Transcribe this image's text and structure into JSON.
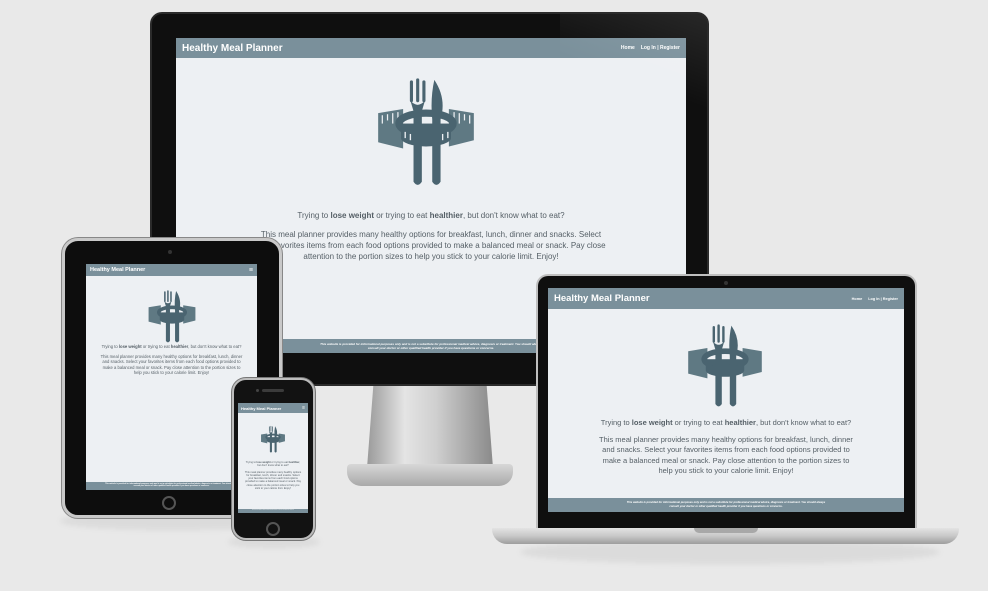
{
  "site": {
    "brand": "Healthy Meal Planner",
    "nav": {
      "home": "Home",
      "login": "Log In | Register"
    },
    "menu_icon": "≡",
    "hero_icon": "fork-knife-tape-measure-icon",
    "intro": {
      "lead": "Trying to ",
      "bold1": "lose weight",
      "mid": " or trying to eat ",
      "bold2": "healthier",
      "tail": ", but don't know what to eat?"
    },
    "description": "This meal planner provides many healthy options for breakfast, lunch, dinner and snacks. Select your favorites items from each food options provided to make a balanced meal or snack. Pay close attention to the portion sizes to help you stick to your calorie limit. Enjoy!",
    "footer": {
      "line1": "This website is provided for informational purposes only and is not a substitute for professional medical advice, diagnosis or treatment. You should always",
      "line2": "consult your doctor or other qualified health provider if you have questions or concerns."
    }
  },
  "colors": {
    "navbar": "#7a909b",
    "screen_bg": "#edf0f3",
    "icon": "#4a6470",
    "text": "#555f66",
    "page_bg": "#e9e9e9"
  }
}
